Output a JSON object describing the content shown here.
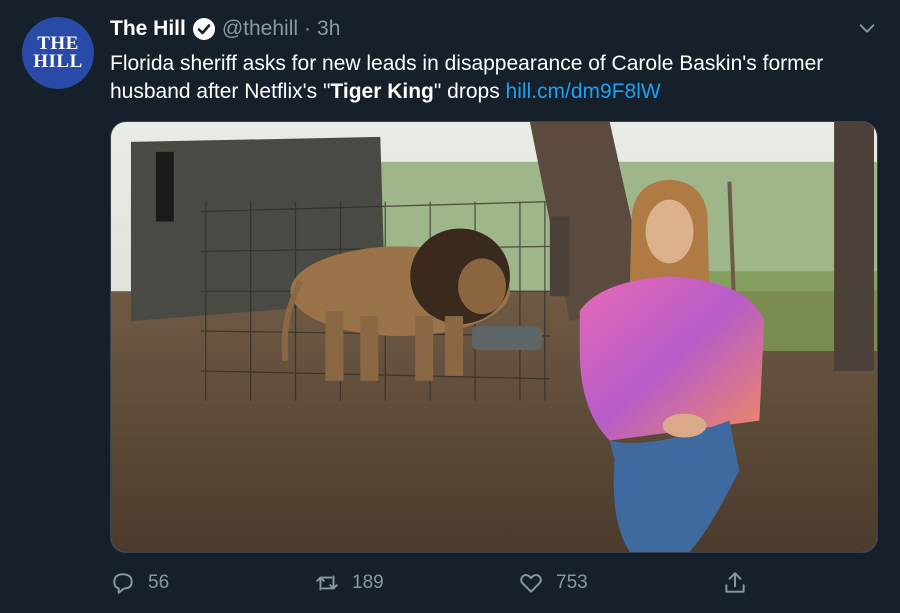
{
  "account": {
    "avatar_line1": "THE",
    "avatar_line2": "HILL",
    "name": "The Hill",
    "handle": "@thehill",
    "separator": "·",
    "time": "3h"
  },
  "tweet": {
    "text_part1": "Florida sheriff asks for new leads in disappearance of Carole Baskin's former husband after Netflix's \"",
    "text_bold": "Tiger King",
    "text_part2": "\" drops ",
    "link": "hill.cm/dm9F8lW"
  },
  "actions": {
    "reply_count": "56",
    "retweet_count": "189",
    "like_count": "753"
  },
  "icons": {
    "verified": "verified-badge-icon",
    "menu": "chevron-down-icon",
    "reply": "reply-icon",
    "retweet": "retweet-icon",
    "like": "heart-icon",
    "share": "share-icon"
  },
  "colors": {
    "background": "#15202b",
    "secondary_text": "#8899a6",
    "link": "#1da1f2",
    "avatar": "#2a4aa8"
  }
}
